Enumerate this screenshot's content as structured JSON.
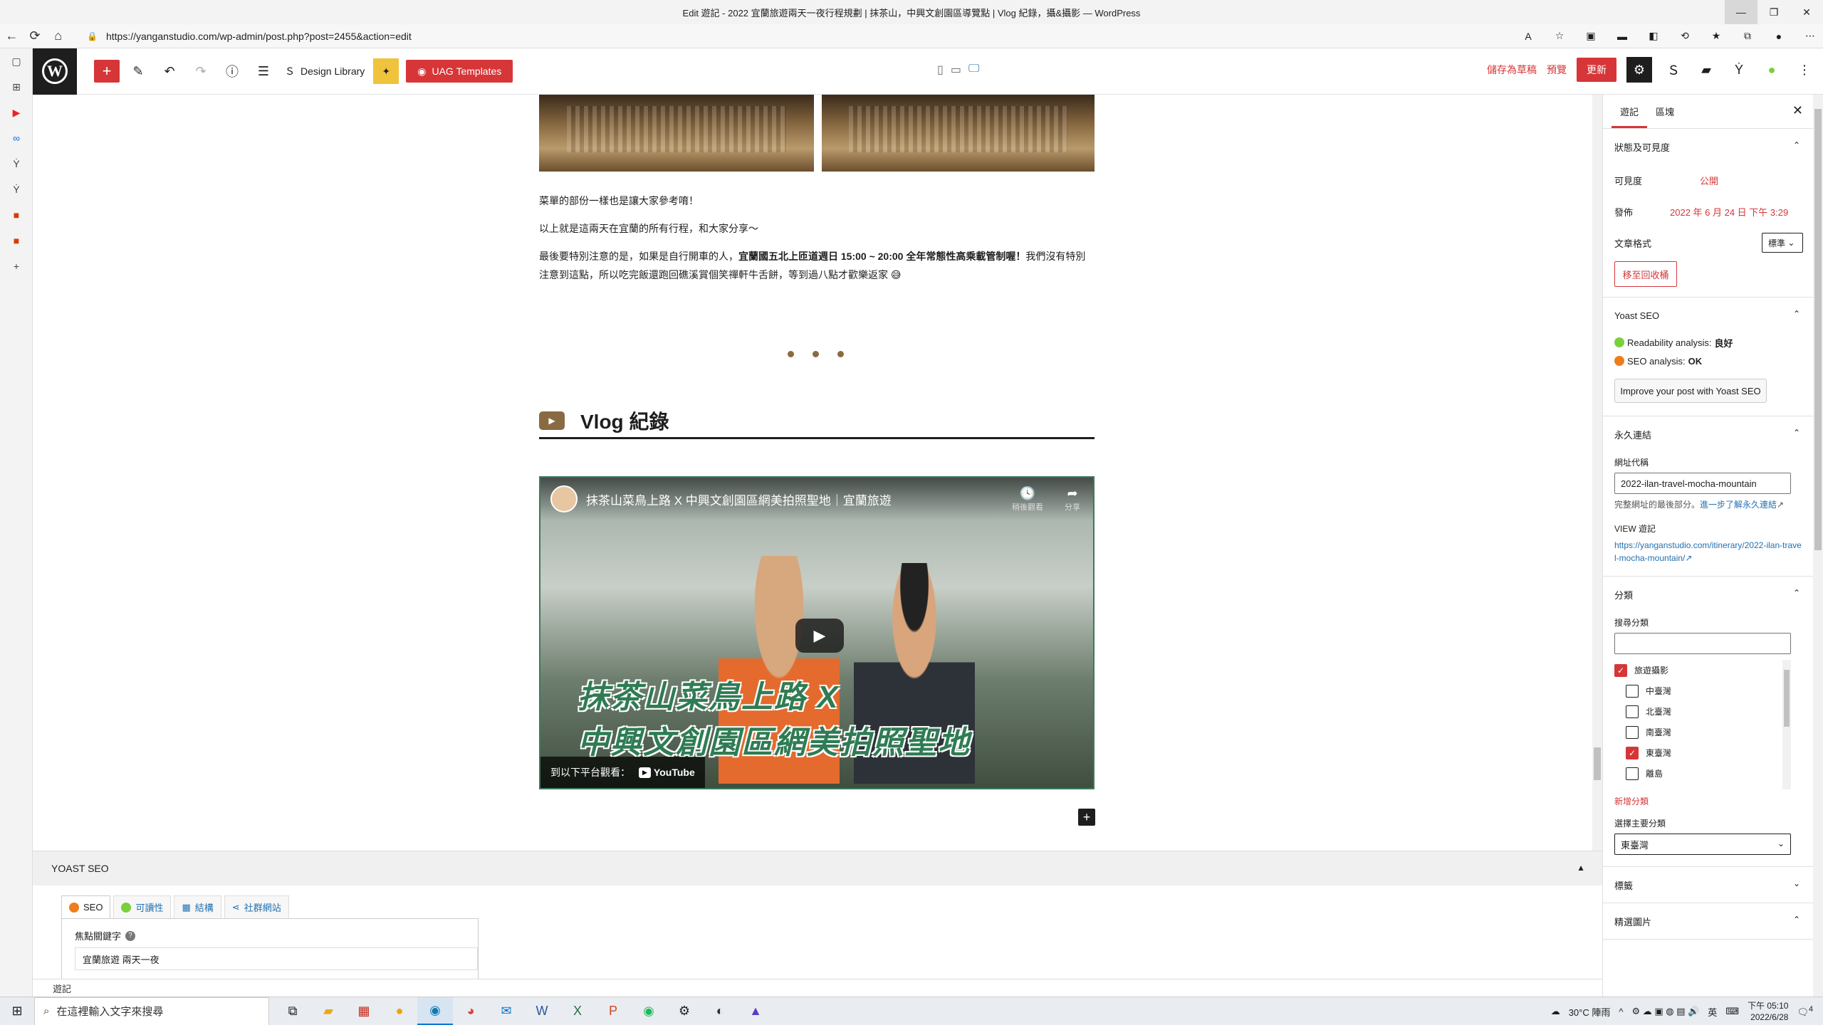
{
  "browser": {
    "title": "Edit 遊記 - 2022 宜蘭旅遊兩天一夜行程規劃 | 抹茶山，中興文創園區導覽點 | Vlog 紀錄，攝&攝影 — WordPress",
    "url": "https://yanganstudio.com/wp-admin/post.php?post=2455&action=edit",
    "window_controls": [
      "—",
      "❐",
      "✕"
    ]
  },
  "toolbar": {
    "design_library": "Design Library",
    "uag_templates": "UAG Templates",
    "save_draft": "儲存為草稿",
    "preview": "預覽",
    "update": "更新"
  },
  "content": {
    "para1": "菜單的部份一樣也是讓大家參考唷！",
    "para2": "以上就是這兩天在宜蘭的所有行程，和大家分享～",
    "para3_a": "最後要特別注意的是，如果是自行開車的人，",
    "para3_bold": "宜蘭國五北上匝道週日 15:00 ~ 20:00 全年常態性高乘載管制喔！",
    "para3_b": "我們沒有特別注意到這點，所以吃完飯還跑回礁溪賞個笑禪軒牛舌餅，等到過八點才歡樂返家",
    "emoji": "😅",
    "heading": "Vlog 紀錄",
    "video_title": "抹茶山菜鳥上路 X 中興文創園區網美拍照聖地｜宜蘭旅遊",
    "video_watch_later": "稍後觀看",
    "video_share": "分享",
    "video_caption_line1": "抹茶山菜鳥上路 X",
    "video_caption_line2": "中興文創園區網美拍照聖地",
    "video_watch_on": "到以下平台觀看：",
    "video_youtube": "YouTube"
  },
  "yoast_panel": {
    "title": "YOAST SEO",
    "tabs": [
      "SEO",
      "可讀性",
      "結構",
      "社群網站"
    ],
    "focus_label": "焦點關鍵字",
    "focus_value": "宜蘭旅遊 兩天一夜"
  },
  "statusline": "遊記",
  "sidebar": {
    "tabs": [
      "遊記",
      "區塊"
    ],
    "status_section": "狀態及可見度",
    "visibility_label": "可見度",
    "visibility_value": "公開",
    "publish_label": "發佈",
    "publish_value": "2022 年 6 月 24 日 下午 3:29",
    "format_label": "文章格式",
    "format_value": "標準",
    "trash": "移至回收桶",
    "yoast_section": "Yoast SEO",
    "readability_label": "Readability analysis:",
    "readability_value": "良好",
    "seo_label": "SEO analysis:",
    "seo_value": "OK",
    "improve": "Improve your post with Yoast SEO",
    "permalink_section": "永久連結",
    "slug_label": "網址代稱",
    "slug_value": "2022-ilan-travel-mocha-mountain",
    "slug_help": "完整網址的最後部分。",
    "slug_help_link": "進一步了解永久連結",
    "view_label": "VIEW 遊記",
    "view_url": "https://yanganstudio.com/itinerary/2022-ilan-travel-mocha-mountain/",
    "category_section": "分類",
    "search_cat_label": "搜尋分類",
    "categories": [
      {
        "label": "旅遊攝影",
        "checked": true,
        "child": false
      },
      {
        "label": "中臺灣",
        "checked": false,
        "child": true
      },
      {
        "label": "北臺灣",
        "checked": false,
        "child": true
      },
      {
        "label": "南臺灣",
        "checked": false,
        "child": true
      },
      {
        "label": "東臺灣",
        "checked": true,
        "child": true
      },
      {
        "label": "離島",
        "checked": false,
        "child": true
      }
    ],
    "new_category": "新增分類",
    "primary_cat_label": "選擇主要分類",
    "primary_cat_value": "東臺灣",
    "tags_section": "標籤",
    "featured_section": "精選圖片"
  },
  "taskbar": {
    "search_placeholder": "在這裡輸入文字來搜尋",
    "weather": "30°C 陣雨",
    "ime": "英",
    "time": "下午 05:10",
    "date": "2022/6/28",
    "notification_count": "4"
  }
}
